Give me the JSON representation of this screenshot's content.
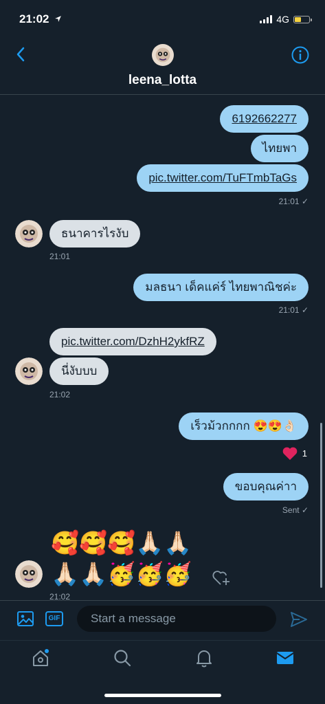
{
  "status": {
    "time": "21:02",
    "network": "4G",
    "battery_level": 0.45,
    "location_arrow": "location-icon"
  },
  "header": {
    "username": "leena_lotta",
    "back_icon": "chevron-left-icon",
    "info_icon": "info-icon"
  },
  "messages": {
    "m1": "6192662277",
    "m2": "ไทยพา",
    "m3": "pic.twitter.com/TuFTmbTaGs",
    "m3_time": "21:01 ✓",
    "m4": "ธนาคารไรงับ",
    "m4_time": "21:01",
    "m5": "มลธนา เด็คแค่ร์ ไทยพาณิชค่ะ",
    "m5_time": "21:01 ✓",
    "m6": "pic.twitter.com/DzhH2ykfRZ",
    "m7": "นี่งับบบ",
    "m7_time": "21:02",
    "m8": "เร็วม้วกกกก 😍😍👌🏻",
    "m8_reaction_count": "1",
    "m9": "ขอบคุณค่าา",
    "m9_status": "Sent ✓",
    "emoji_row_1": "🥰🥰🥰🙏🏻🙏🏻",
    "emoji_row_2": "🙏🏻🙏🏻🥳🥳🥳",
    "emoji_time": "21:02"
  },
  "composer": {
    "placeholder": "Start a message",
    "gif_label": "GIF"
  },
  "colors": {
    "background": "#15202b",
    "outgoing": "#9dd3f5",
    "incoming": "#dbe1e6",
    "accent": "#1d9bf0",
    "heart": "#e0245e"
  },
  "tabs": [
    "home-icon",
    "search-icon",
    "bell-icon",
    "mail-icon"
  ]
}
